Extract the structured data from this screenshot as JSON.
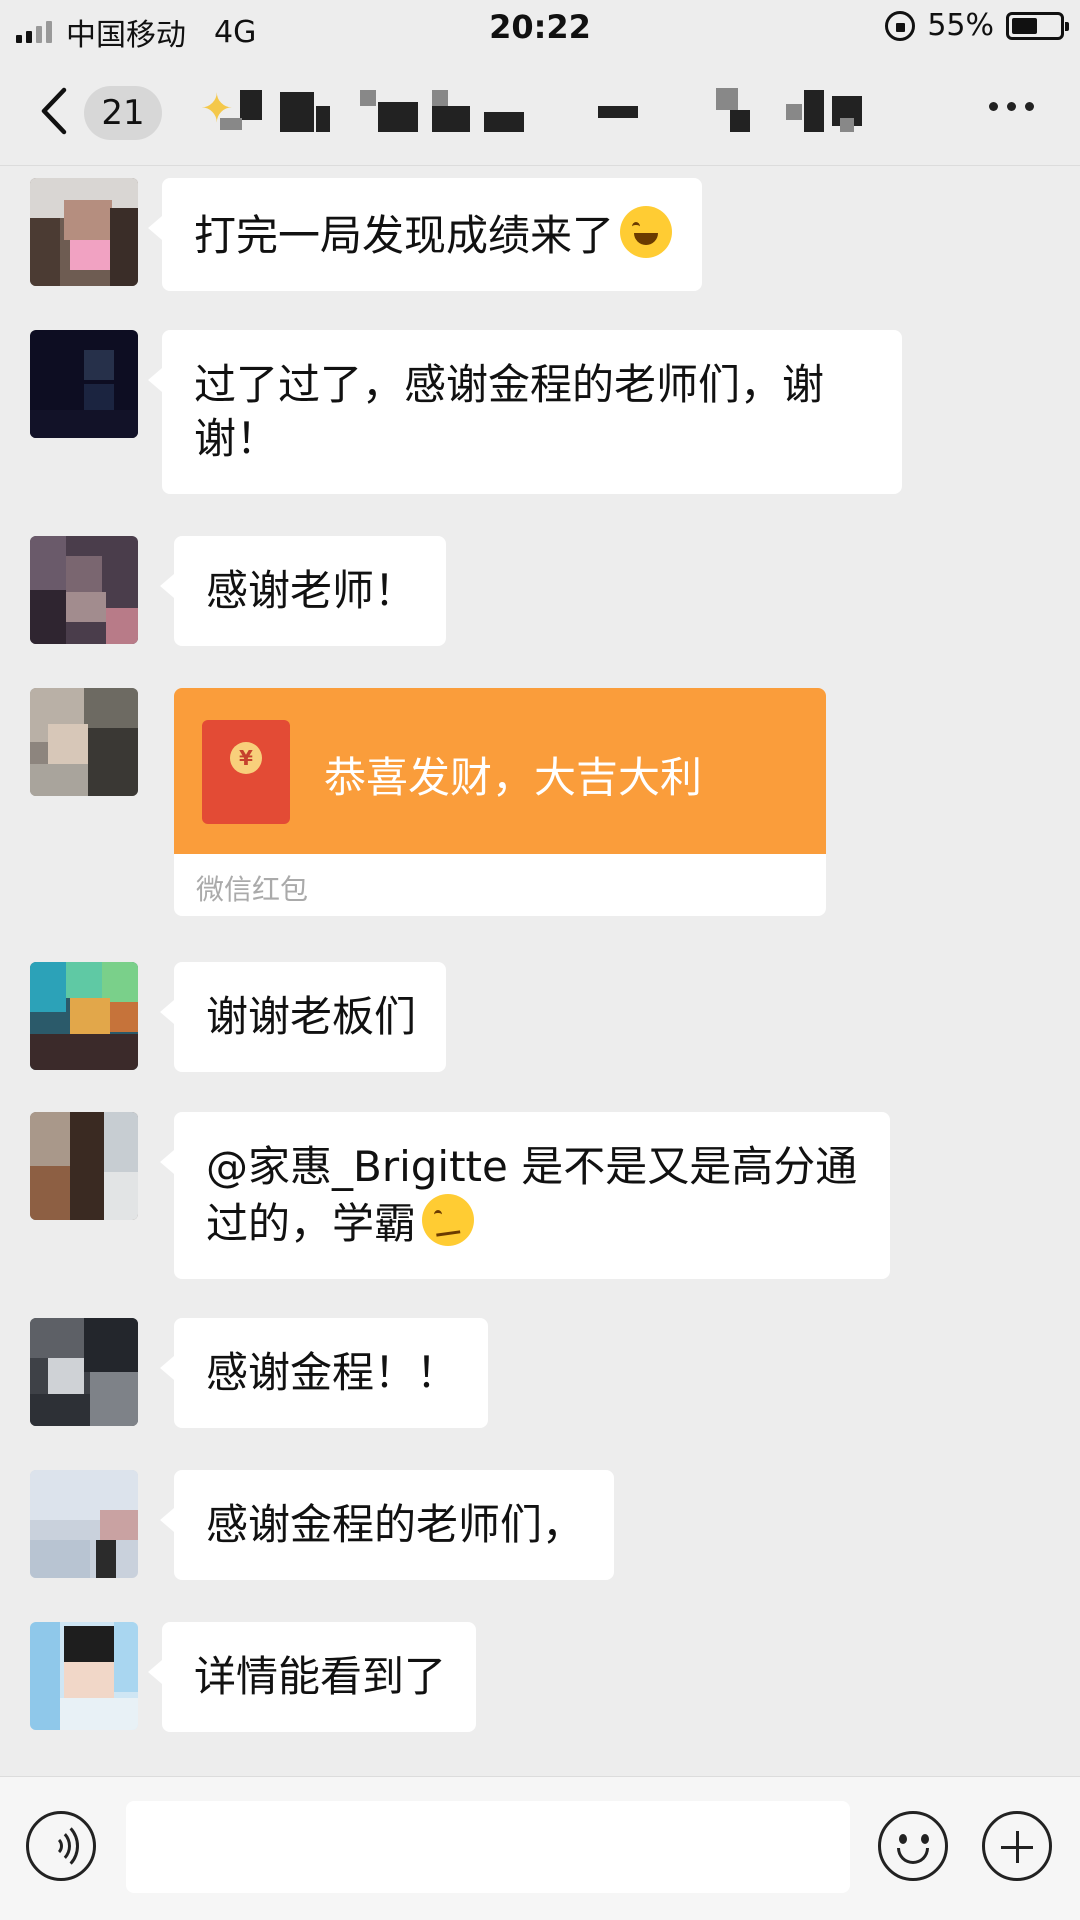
{
  "status_bar": {
    "carrier": "中国移动",
    "network": "4G",
    "time": "20:22",
    "battery_percent": "55%",
    "battery_level": 0.55
  },
  "nav": {
    "unread_count": "21",
    "title_obscured": true
  },
  "messages": [
    {
      "type": "text",
      "text": "打完一局发现成绩来了",
      "emoji": "laugh-tears"
    },
    {
      "type": "text",
      "text": "过了过了，感谢金程的老师们，谢谢！"
    },
    {
      "type": "text",
      "text": "感谢老师！"
    },
    {
      "type": "red_packet",
      "greeting": "恭喜发财，大吉大利",
      "label": "微信红包"
    },
    {
      "type": "text",
      "text": "谢谢老板们"
    },
    {
      "type": "text",
      "text": "@家惠_Brigitte 是不是又是高分通过的，学霸",
      "emoji": "smirk"
    },
    {
      "type": "text",
      "text": "感谢金程！！"
    },
    {
      "type": "text",
      "text": "感谢金程的老师们，"
    },
    {
      "type": "text",
      "text": "详情能看到了"
    }
  ],
  "colors": {
    "background": "#ededed",
    "bubble": "#ffffff",
    "red_packet": "#fa9d3b",
    "red_packet_icon": "#e34b35"
  }
}
